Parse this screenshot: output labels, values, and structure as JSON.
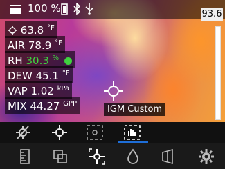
{
  "status": {
    "battery_percent": "100 %"
  },
  "temperature_readout": "93.6",
  "readings": [
    {
      "label": "",
      "value": "63.8",
      "unit": "°F",
      "icon": "crosshair-icon"
    },
    {
      "label": "AIR",
      "value": "78.9",
      "unit": "°F"
    },
    {
      "label": "RH",
      "value": "30.3",
      "unit": "%"
    },
    {
      "label": "DEW",
      "value": "45.1",
      "unit": "°F"
    },
    {
      "label": "VAP",
      "value": "1.02",
      "unit": "kPa"
    },
    {
      "label": "MIX",
      "value": "44.27",
      "unit": "GPP"
    }
  ],
  "mode_label": "IGM Custom",
  "colors": {
    "accent": "#1e6ed8",
    "rh_green": "#3fd23f"
  },
  "icons": {
    "status": [
      "thermal-camera-icon",
      "battery-icon",
      "bluetooth-icon",
      "usb-icon"
    ],
    "modes": [
      "spot-off-icon",
      "spot-meter-icon",
      "area-box-icon",
      "igm-custom-icon"
    ],
    "toolbar": [
      "ruler-icon",
      "layers-icon",
      "measure-point-icon",
      "moisture-drop-icon",
      "palette-icon",
      "settings-gear-icon"
    ]
  }
}
